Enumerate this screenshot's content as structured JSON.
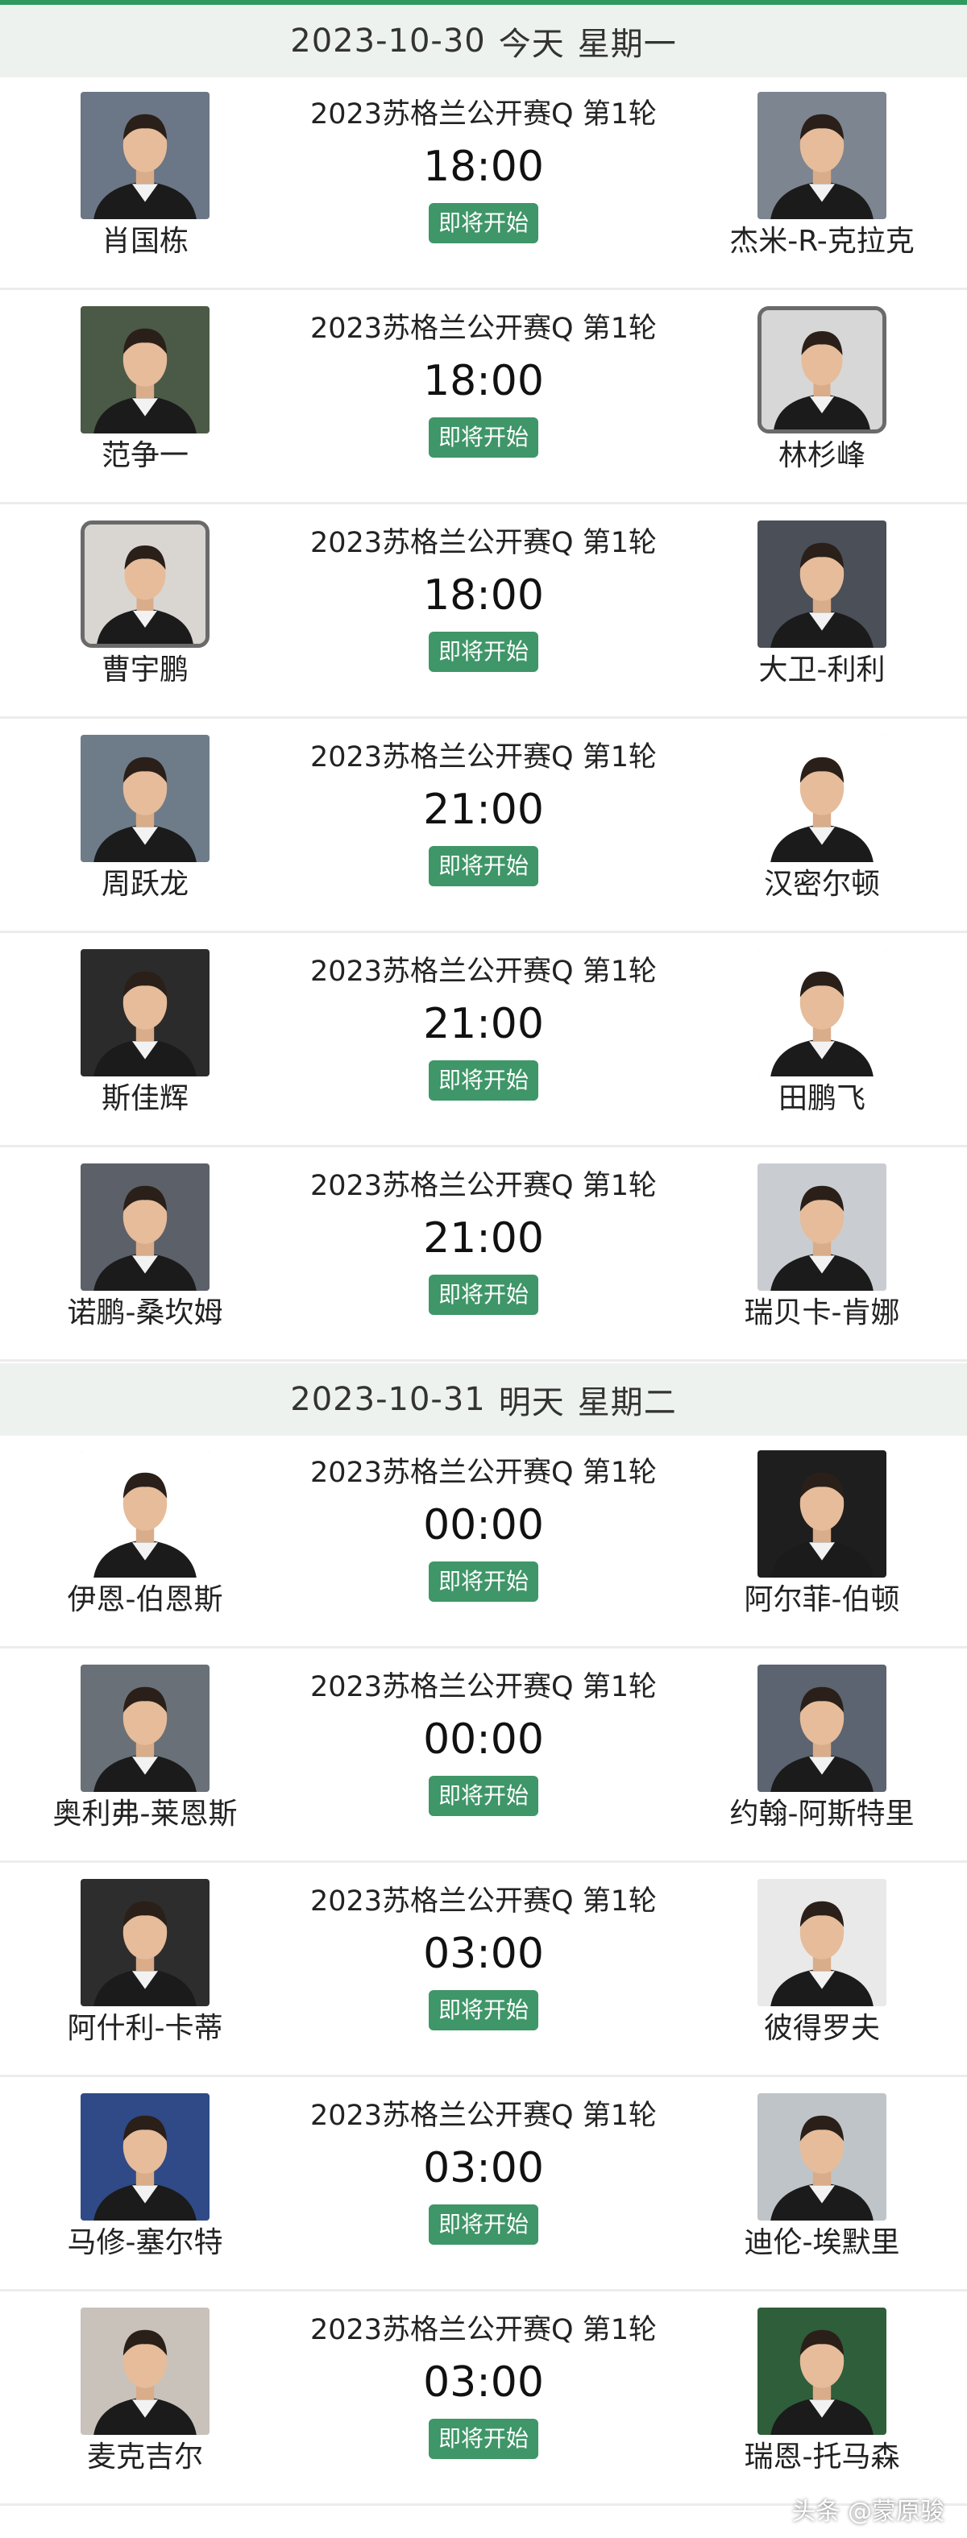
{
  "sections": [
    {
      "header": {
        "date": "2023-10-30",
        "relative": "今天",
        "weekday": "星期一"
      },
      "matches": [
        {
          "home": {
            "name": "肖国栋",
            "avatar": "player-photo",
            "bg": "#6b7686",
            "framed": false
          },
          "tournament": "2023苏格兰公开赛Q 第1轮",
          "time": "18:00",
          "status": "即将开始",
          "away": {
            "name": "杰米-R-克拉克",
            "avatar": "player-photo",
            "bg": "#7d8590",
            "framed": false
          }
        },
        {
          "home": {
            "name": "范争一",
            "avatar": "player-photo",
            "bg": "#4b5a46",
            "framed": false
          },
          "tournament": "2023苏格兰公开赛Q 第1轮",
          "time": "18:00",
          "status": "即将开始",
          "away": {
            "name": "林杉峰",
            "avatar": "player-photo",
            "bg": "#d7d7d7",
            "framed": true
          }
        },
        {
          "home": {
            "name": "曹宇鹏",
            "avatar": "player-photo",
            "bg": "#d9d6d2",
            "framed": true
          },
          "tournament": "2023苏格兰公开赛Q 第1轮",
          "time": "18:00",
          "status": "即将开始",
          "away": {
            "name": "大卫-利利",
            "avatar": "player-photo",
            "bg": "#4a4f58",
            "framed": false
          }
        },
        {
          "home": {
            "name": "周跃龙",
            "avatar": "player-photo",
            "bg": "#6e7c89",
            "framed": false
          },
          "tournament": "2023苏格兰公开赛Q 第1轮",
          "time": "21:00",
          "status": "即将开始",
          "away": {
            "name": "汉密尔顿",
            "avatar": "player-photo",
            "bg": "#ffffff",
            "framed": false
          }
        },
        {
          "home": {
            "name": "斯佳辉",
            "avatar": "player-photo",
            "bg": "#2b2b2b",
            "framed": false
          },
          "tournament": "2023苏格兰公开赛Q 第1轮",
          "time": "21:00",
          "status": "即将开始",
          "away": {
            "name": "田鹏飞",
            "avatar": "player-photo",
            "bg": "#ffffff",
            "framed": false
          }
        },
        {
          "home": {
            "name": "诺鹏-桑坎姆",
            "avatar": "player-photo",
            "bg": "#5c6068",
            "framed": false
          },
          "tournament": "2023苏格兰公开赛Q 第1轮",
          "time": "21:00",
          "status": "即将开始",
          "away": {
            "name": "瑞贝卡-肯娜",
            "avatar": "player-photo",
            "bg": "#c9cdd2",
            "framed": false
          }
        }
      ]
    },
    {
      "header": {
        "date": "2023-10-31",
        "relative": "明天",
        "weekday": "星期二"
      },
      "matches": [
        {
          "home": {
            "name": "伊恩-伯恩斯",
            "avatar": "player-photo",
            "bg": "#ffffff",
            "framed": false
          },
          "tournament": "2023苏格兰公开赛Q 第1轮",
          "time": "00:00",
          "status": "即将开始",
          "away": {
            "name": "阿尔菲-伯顿",
            "avatar": "player-photo",
            "bg": "#1e1e1e",
            "framed": false
          }
        },
        {
          "home": {
            "name": "奥利弗-莱恩斯",
            "avatar": "player-photo",
            "bg": "#6a7077",
            "framed": false
          },
          "tournament": "2023苏格兰公开赛Q 第1轮",
          "time": "00:00",
          "status": "即将开始",
          "away": {
            "name": "约翰-阿斯特里",
            "avatar": "player-photo",
            "bg": "#5b6470",
            "framed": false
          }
        },
        {
          "home": {
            "name": "阿什利-卡蒂",
            "avatar": "player-photo",
            "bg": "#2d2d2d",
            "framed": false
          },
          "tournament": "2023苏格兰公开赛Q 第1轮",
          "time": "03:00",
          "status": "即将开始",
          "away": {
            "name": "彼得罗夫",
            "avatar": "player-photo",
            "bg": "#e9e9e9",
            "framed": false
          }
        },
        {
          "home": {
            "name": "马修-塞尔特",
            "avatar": "player-photo",
            "bg": "#2f4a86",
            "framed": false
          },
          "tournament": "2023苏格兰公开赛Q 第1轮",
          "time": "03:00",
          "status": "即将开始",
          "away": {
            "name": "迪伦-埃默里",
            "avatar": "player-photo",
            "bg": "#bfc4c8",
            "framed": false
          }
        },
        {
          "home": {
            "name": "麦克吉尔",
            "avatar": "player-photo",
            "bg": "#c8c2bb",
            "framed": false
          },
          "tournament": "2023苏格兰公开赛Q 第1轮",
          "time": "03:00",
          "status": "即将开始",
          "away": {
            "name": "瑞恩-托马森",
            "avatar": "player-photo",
            "bg": "#2f5e3a",
            "framed": false
          }
        }
      ]
    }
  ],
  "watermark": "头条 @蒙原骏"
}
